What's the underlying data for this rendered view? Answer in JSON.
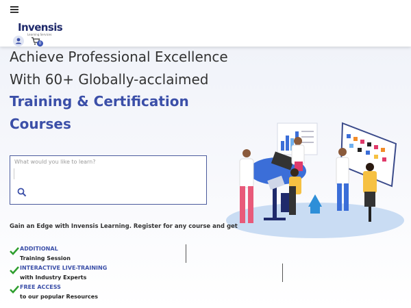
{
  "header": {
    "logo_text": "Invensis",
    "logo_tagline": "Learning Services",
    "cart_count": "0",
    "icons": [
      "menu-icon",
      "user-icon",
      "cart-icon"
    ]
  },
  "hero": {
    "line1": "Achieve Professional Excellence",
    "line2": "With 60+ Globally-acclaimed",
    "line3": "Training & Certification",
    "line4": "Courses"
  },
  "search": {
    "placeholder": "What would you like to learn?",
    "value": ""
  },
  "promo": {
    "text": "Gain an Edge with Invensis Learning. Register for any course and get"
  },
  "benefits": [
    {
      "title": "ADDITIONAL",
      "subtitle": "Training Session"
    },
    {
      "title": "INTERACTIVE LIVE-TRAINING",
      "subtitle": "with Industry Experts"
    },
    {
      "title": "FREE ACCESS",
      "subtitle": "to our popular Resources"
    }
  ],
  "colors": {
    "accent": "#3b4fa8",
    "check": "#2e9e2e",
    "border": "#4a5a9c"
  }
}
